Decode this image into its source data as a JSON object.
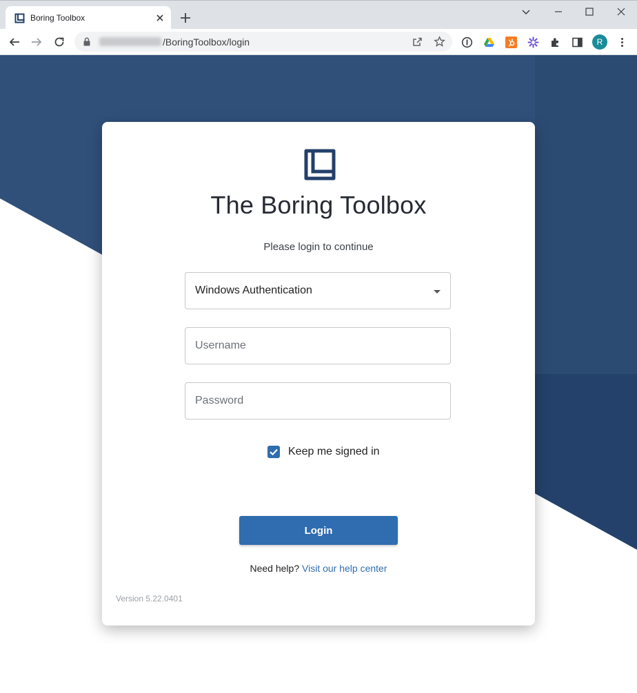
{
  "browser": {
    "tab_title": "Boring Toolbox",
    "url_path": "/BoringToolbox/login",
    "profile_initial": "R"
  },
  "login": {
    "app_title": "The Boring Toolbox",
    "subtitle": "Please login to continue",
    "auth_method": "Windows Authentication",
    "username_placeholder": "Username",
    "password_placeholder": "Password",
    "keep_signed_in_label": "Keep me signed in",
    "keep_signed_in_checked": true,
    "login_button": "Login",
    "help_prefix": "Need help?",
    "help_link": "Visit our help center",
    "version": "Version 5.22.0401"
  },
  "colors": {
    "brand_dark": "#2e4a72",
    "accent": "#2f6db0"
  }
}
